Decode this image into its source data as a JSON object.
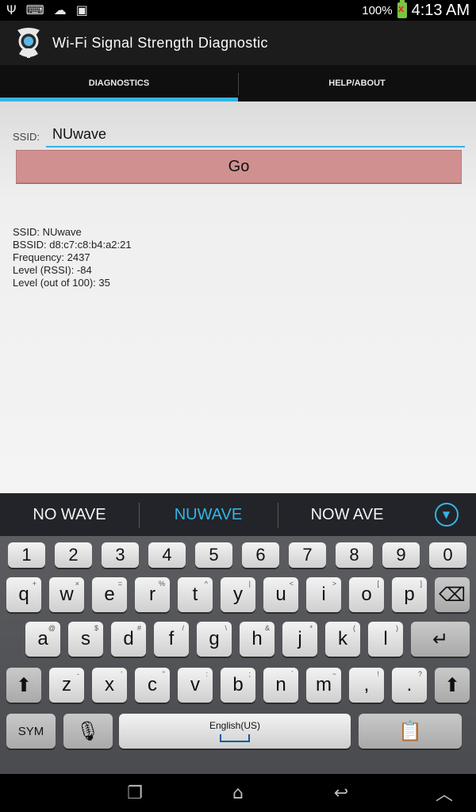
{
  "status_bar": {
    "icons": [
      "usb-icon",
      "keyboard-icon",
      "cloud-upload-icon",
      "image-icon"
    ],
    "battery_percent": "100%",
    "time": "4:13 AM"
  },
  "app": {
    "title": "Wi-Fi Signal Strength Diagnostic"
  },
  "tabs": [
    {
      "label": "DIAGNOSTICS",
      "active": true
    },
    {
      "label": "HELP/ABOUT",
      "active": false
    }
  ],
  "form": {
    "ssid_label": "SSID:",
    "ssid_value": "NUwave",
    "go_label": "Go"
  },
  "results": [
    "SSID: NUwave",
    "BSSID: d8:c7:c8:b4:a2:21",
    "Frequency: 2437",
    "Level (RSSI): -84",
    "Level (out of 100): 35"
  ],
  "suggestions": [
    "NO WAVE",
    "NUWAVE",
    "NOW AVE"
  ],
  "keyboard": {
    "row_numbers": [
      "1",
      "2",
      "3",
      "4",
      "5",
      "6",
      "7",
      "8",
      "9",
      "0"
    ],
    "row1": [
      {
        "k": "q",
        "s": "+"
      },
      {
        "k": "w",
        "s": "×"
      },
      {
        "k": "e",
        "s": "="
      },
      {
        "k": "r",
        "s": "%"
      },
      {
        "k": "t",
        "s": "^"
      },
      {
        "k": "y",
        "s": "|"
      },
      {
        "k": "u",
        "s": "<"
      },
      {
        "k": "i",
        "s": ">"
      },
      {
        "k": "o",
        "s": "["
      },
      {
        "k": "p",
        "s": "]"
      }
    ],
    "row2": [
      {
        "k": "a",
        "s": "@"
      },
      {
        "k": "s",
        "s": "$"
      },
      {
        "k": "d",
        "s": "#"
      },
      {
        "k": "f",
        "s": "/"
      },
      {
        "k": "g",
        "s": "\\"
      },
      {
        "k": "h",
        "s": "&"
      },
      {
        "k": "j",
        "s": "*"
      },
      {
        "k": "k",
        "s": "("
      },
      {
        "k": "l",
        "s": ")"
      }
    ],
    "row3": [
      {
        "k": "z",
        "s": "-"
      },
      {
        "k": "x",
        "s": "'"
      },
      {
        "k": "c",
        "s": "\""
      },
      {
        "k": "v",
        "s": ":"
      },
      {
        "k": "b",
        "s": ";"
      },
      {
        "k": "n",
        "s": "`"
      },
      {
        "k": "m",
        "s": "~"
      },
      {
        "k": ",",
        "s": "!"
      },
      {
        "k": ".",
        "s": "?"
      }
    ],
    "sym_label": "SYM",
    "language_label": "English(US)"
  },
  "colors": {
    "accent": "#33b5e5",
    "go_button": "#d09090"
  }
}
